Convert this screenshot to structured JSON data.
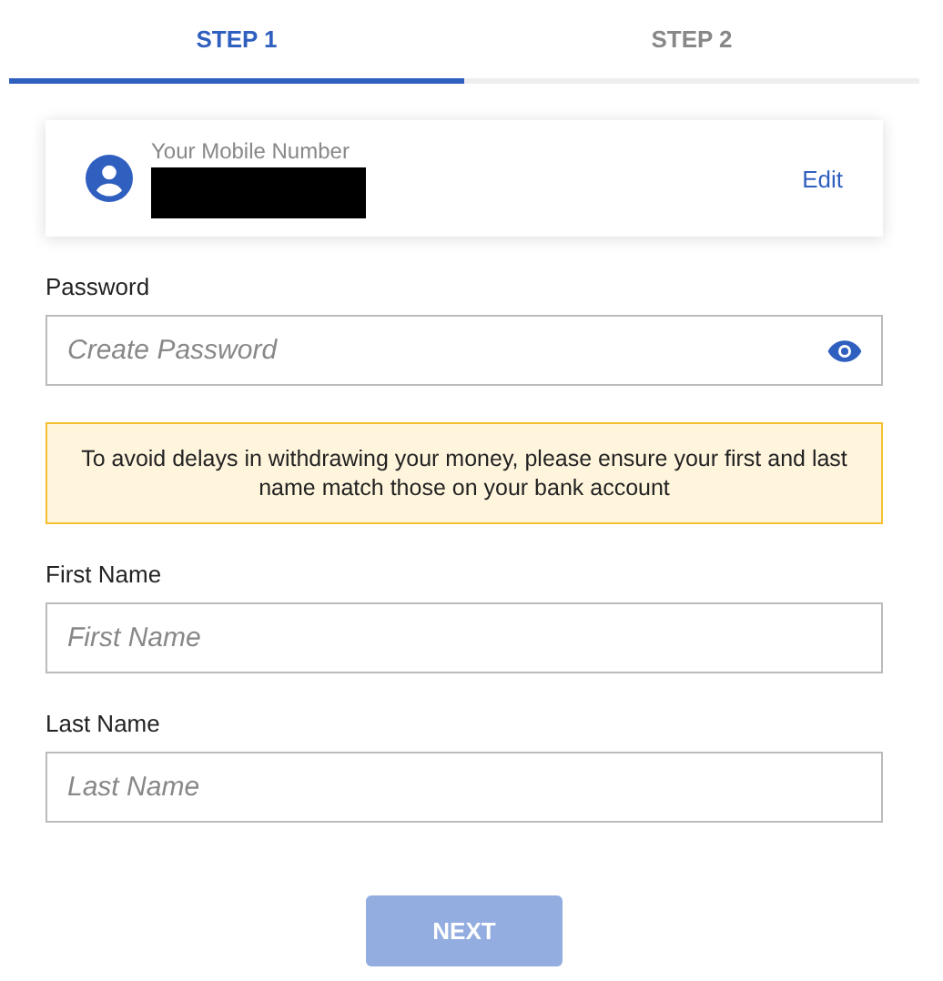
{
  "tabs": [
    {
      "label": "STEP 1",
      "selected": true
    },
    {
      "label": "STEP 2",
      "selected": false
    }
  ],
  "account_card": {
    "label": "Your Mobile Number",
    "number_redacted": true,
    "action": "Edit"
  },
  "password": {
    "label": "Password",
    "placeholder": "Create Password"
  },
  "notice": "To avoid delays in withdrawing your money, please ensure your first and last name match those on your bank account",
  "fields": [
    {
      "label": "First Name",
      "placeholder": "First Name"
    },
    {
      "label": "Last Name",
      "placeholder": "Last Name"
    }
  ],
  "next_button": {
    "label": "NEXT",
    "disabled": true
  }
}
